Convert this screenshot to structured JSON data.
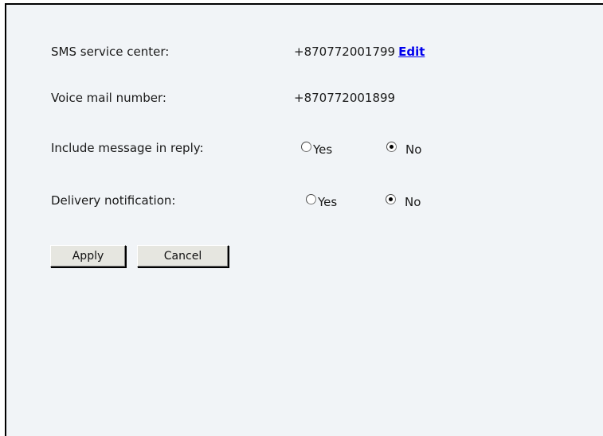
{
  "sms_service_center": {
    "label": "SMS service center:",
    "value": "+870772001799",
    "edit_label": "Edit"
  },
  "voice_mail_number": {
    "label": "Voice mail number:",
    "value": "+870772001899"
  },
  "include_message_in_reply": {
    "label": "Include message in reply:",
    "options": [
      {
        "label": "Yes",
        "checked": false
      },
      {
        "label": "No",
        "checked": true
      }
    ]
  },
  "delivery_notification": {
    "label": "Delivery notification:",
    "options": [
      {
        "label": "Yes",
        "checked": false
      },
      {
        "label": "No",
        "checked": true
      }
    ]
  },
  "buttons": {
    "apply_label": "Apply",
    "cancel_label": "Cancel"
  },
  "colors": {
    "panel_background": "#f1f4f7",
    "link": "#0000ee",
    "button_face": "#e6e6e0"
  }
}
